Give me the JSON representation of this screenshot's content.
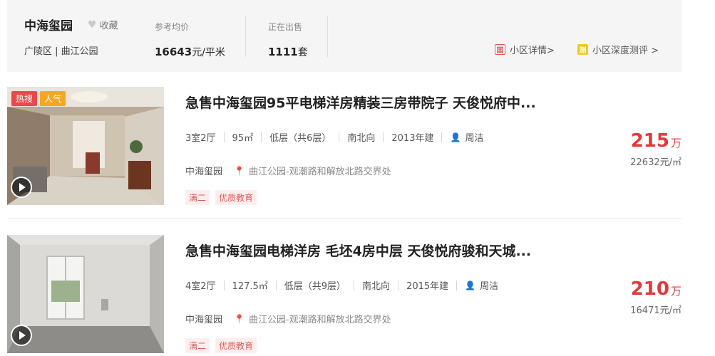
{
  "community": {
    "name": "中海玺园",
    "favorite_label": "收藏",
    "location": "广陵区 | 曲江公园",
    "avg_price_label": "参考均价",
    "avg_price_value": "16643",
    "avg_price_unit": "元/平米",
    "on_sale_label": "正在出售",
    "on_sale_value": "1111",
    "on_sale_unit": "套",
    "detail_link": "小区详情>",
    "review_link": "小区深度测评 >",
    "detail_icon": "囯",
    "review_icon": "测"
  },
  "listings": [
    {
      "badges": [
        "热搜",
        "人气"
      ],
      "title": "急售中海玺园95平电梯洋房精装三房带院子 天俊悦府中...",
      "layout": "3室2厅",
      "area": "95㎡",
      "floor": "低层（共6层）",
      "orientation": "南北向",
      "year": "2013年建",
      "agent": "周洁",
      "community": "中海玺园",
      "address": "曲江公园-观潮路和解放北路交界处",
      "tags": [
        "满二",
        "优质教育"
      ],
      "price_total": "215",
      "price_unit": "万",
      "price_per": "22632元/㎡"
    },
    {
      "badges": [],
      "title": "急售中海玺园电梯洋房 毛坯4房中层 天俊悦府骏和天城...",
      "layout": "4室2厅",
      "area": "127.5㎡",
      "floor": "低层（共9层）",
      "orientation": "南北向",
      "year": "2015年建",
      "agent": "周洁",
      "community": "中海玺园",
      "address": "曲江公园-观潮路和解放北路交界处",
      "tags": [
        "满二",
        "优质教育"
      ],
      "price_total": "210",
      "price_unit": "万",
      "price_per": "16471元/㎡"
    }
  ]
}
